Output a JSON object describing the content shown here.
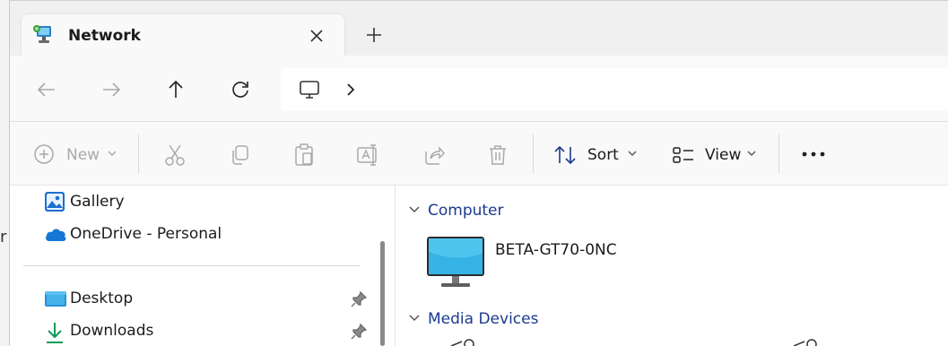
{
  "window": {
    "title": "Network"
  },
  "background": {
    "edge_text": "r"
  },
  "tabs": [
    {
      "label": "Network",
      "icon": "network-icon",
      "close_icon": "close-icon"
    }
  ],
  "new_tab_icon": "plus-icon",
  "navigation": {
    "back_icon": "arrow-left-icon",
    "forward_icon": "arrow-right-icon",
    "up_icon": "arrow-up-icon",
    "refresh_icon": "refresh-icon",
    "address": {
      "location_icon": "this-pc-icon",
      "chevron_icon": "chevron-right-icon"
    }
  },
  "toolbar": {
    "new_label": "New",
    "cut_icon": "scissors-icon",
    "copy_icon": "copy-icon",
    "paste_icon": "paste-icon",
    "rename_icon": "rename-icon",
    "share_icon": "share-icon",
    "delete_icon": "trash-icon",
    "sort_label": "Sort",
    "view_label": "View",
    "more_icon": "more-icon"
  },
  "sidebar": {
    "items": [
      {
        "label": "Gallery",
        "icon": "gallery-icon"
      },
      {
        "label": "OneDrive - Personal",
        "icon": "cloud-icon"
      },
      {
        "label": "Desktop",
        "icon": "desktop-folder-icon",
        "pinned": true
      },
      {
        "label": "Downloads",
        "icon": "download-icon",
        "pinned": true
      }
    ]
  },
  "content": {
    "groups": [
      {
        "label": "Computer",
        "items": [
          {
            "name": "BETA-GT70-0NC",
            "icon": "monitor-icon"
          }
        ]
      },
      {
        "label": "Media Devices",
        "items": []
      }
    ]
  },
  "colors": {
    "accent": "#1a3a8f",
    "disabled": "#a9a9a9",
    "monitor": "#35b3e5",
    "onedrive": "#1478d4",
    "download": "#0f9b5a"
  }
}
